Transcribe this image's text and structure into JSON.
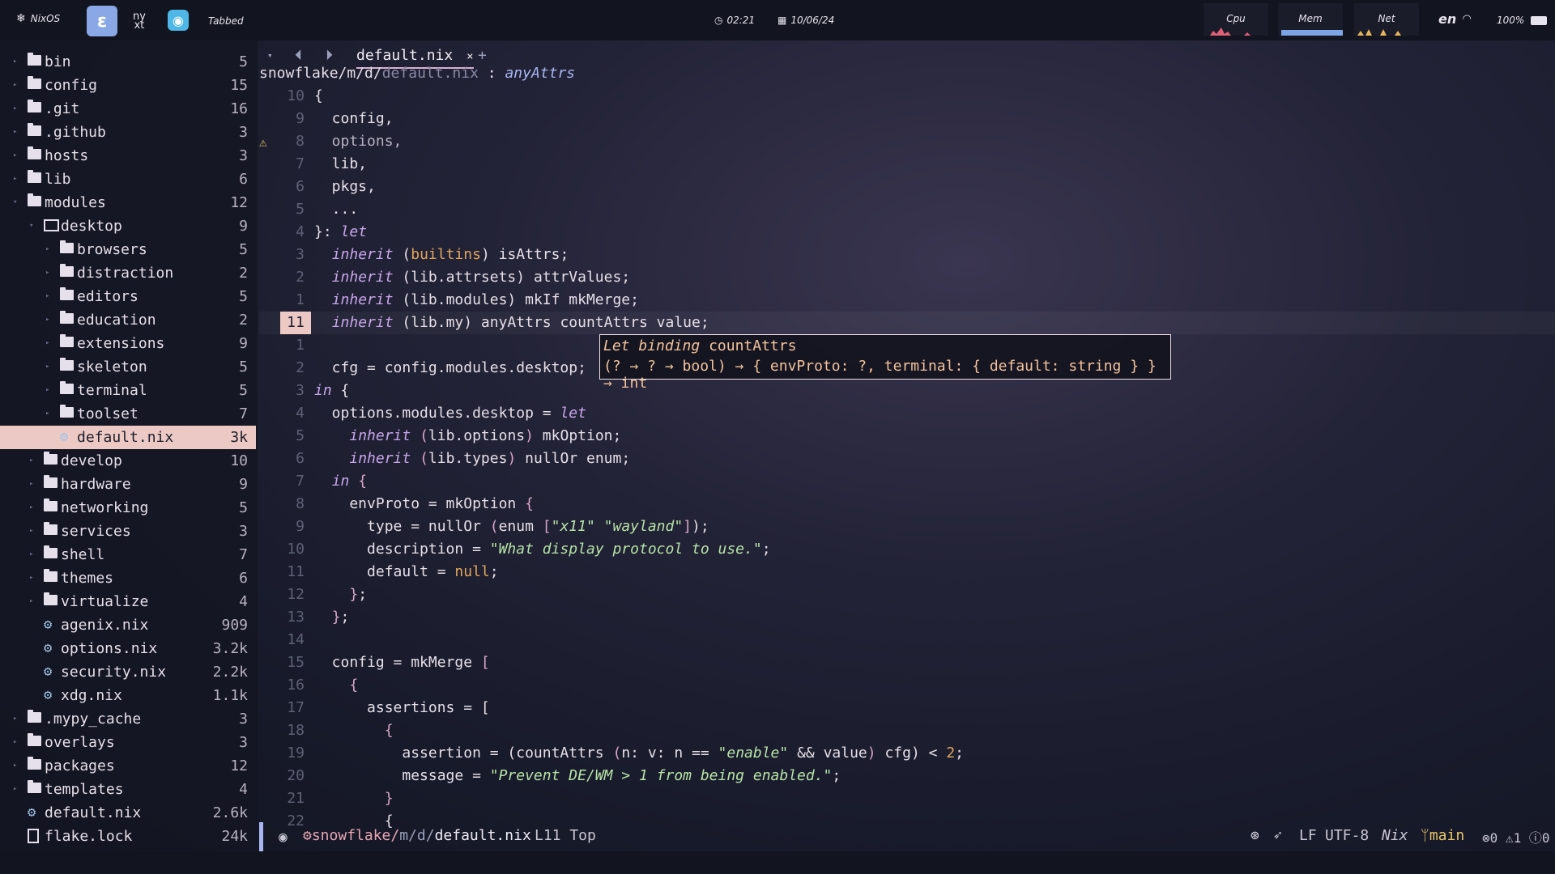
{
  "topbar": {
    "os_label": "NixOS",
    "ws2_text": "ny\nxt",
    "layout": "Tabbed",
    "clock": "02:21",
    "date": "10/06/24",
    "cpu_label": "Cpu",
    "mem_label": "Mem",
    "net_label": "Net",
    "lang": "en",
    "battery": "100%"
  },
  "sidebar": {
    "items": [
      {
        "label": "bin",
        "count": "5",
        "type": "folder",
        "depth": 0
      },
      {
        "label": "config",
        "count": "15",
        "type": "folder",
        "depth": 0
      },
      {
        "label": ".git",
        "count": "16",
        "type": "folder-git",
        "depth": 0
      },
      {
        "label": ".github",
        "count": "3",
        "type": "folder-git",
        "depth": 0
      },
      {
        "label": "hosts",
        "count": "3",
        "type": "folder",
        "depth": 0
      },
      {
        "label": "lib",
        "count": "6",
        "type": "folder",
        "depth": 0
      },
      {
        "label": "modules",
        "count": "12",
        "type": "folder",
        "depth": 0,
        "open": true
      },
      {
        "label": "desktop",
        "count": "9",
        "type": "monitor",
        "depth": 1,
        "open": true
      },
      {
        "label": "browsers",
        "count": "5",
        "type": "folder",
        "depth": 2
      },
      {
        "label": "distraction",
        "count": "2",
        "type": "folder",
        "depth": 2
      },
      {
        "label": "editors",
        "count": "5",
        "type": "folder",
        "depth": 2
      },
      {
        "label": "education",
        "count": "2",
        "type": "folder",
        "depth": 2
      },
      {
        "label": "extensions",
        "count": "9",
        "type": "folder",
        "depth": 2
      },
      {
        "label": "skeleton",
        "count": "5",
        "type": "folder",
        "depth": 2
      },
      {
        "label": "terminal",
        "count": "5",
        "type": "folder",
        "depth": 2
      },
      {
        "label": "toolset",
        "count": "7",
        "type": "folder",
        "depth": 2
      },
      {
        "label": "default.nix",
        "count": "3k",
        "type": "nix",
        "depth": 2,
        "selected": true
      },
      {
        "label": "develop",
        "count": "10",
        "type": "folder",
        "depth": 1
      },
      {
        "label": "hardware",
        "count": "9",
        "type": "folder",
        "depth": 1
      },
      {
        "label": "networking",
        "count": "5",
        "type": "folder",
        "depth": 1
      },
      {
        "label": "services",
        "count": "3",
        "type": "folder",
        "depth": 1
      },
      {
        "label": "shell",
        "count": "7",
        "type": "folder",
        "depth": 1
      },
      {
        "label": "themes",
        "count": "6",
        "type": "folder",
        "depth": 1
      },
      {
        "label": "virtualize",
        "count": "4",
        "type": "folder",
        "depth": 1
      },
      {
        "label": "agenix.nix",
        "count": "909",
        "type": "nix",
        "depth": 1
      },
      {
        "label": "options.nix",
        "count": "3.2k",
        "type": "nix",
        "depth": 1
      },
      {
        "label": "security.nix",
        "count": "2.2k",
        "type": "nix",
        "depth": 1
      },
      {
        "label": "xdg.nix",
        "count": "1.1k",
        "type": "nix",
        "depth": 1
      },
      {
        "label": ".mypy_cache",
        "count": "3",
        "type": "folder",
        "depth": 0
      },
      {
        "label": "overlays",
        "count": "3",
        "type": "folder",
        "depth": 0
      },
      {
        "label": "packages",
        "count": "12",
        "type": "folder",
        "depth": 0
      },
      {
        "label": "templates",
        "count": "4",
        "type": "folder",
        "depth": 0
      },
      {
        "label": "default.nix",
        "count": "2.6k",
        "type": "nix",
        "depth": 0
      },
      {
        "label": "flake.lock",
        "count": "24k",
        "type": "file",
        "depth": 0
      }
    ]
  },
  "tabline": {
    "tab": "default.nix",
    "close": "×",
    "new": "+"
  },
  "breadcrumb": {
    "path_a": "snowflake/m/d/",
    "path_b": "default.nix",
    "sep": " : ",
    "symbol": "anyAttrs"
  },
  "editor": {
    "lines": [
      {
        "ln": "10",
        "html": "{"
      },
      {
        "ln": "9",
        "html": "  config,"
      },
      {
        "ln": "8",
        "html": "  options,",
        "dim": true
      },
      {
        "ln": "7",
        "html": "  lib,"
      },
      {
        "ln": "6",
        "html": "  pkgs,"
      },
      {
        "ln": "5",
        "html": "  ..."
      },
      {
        "ln": "4",
        "html": "}: <span class=kw>let</span>"
      },
      {
        "ln": "3",
        "html": "  <span class=kw>inherit</span> (<span class=lit>builtins</span>) isAttrs;"
      },
      {
        "ln": "2",
        "html": "  <span class=kw>inherit</span> (lib.attrsets) attrValues;"
      },
      {
        "ln": "1",
        "html": "  <span class=kw>inherit</span> (lib.modules) mkIf mkMerge;"
      },
      {
        "ln": "11",
        "html": "  <span class=kw>inherit</span> (lib.my) anyAttrs countAttrs value;",
        "current": true
      },
      {
        "ln": "1",
        "html": ""
      },
      {
        "ln": "2",
        "html": "  cfg = config.modules.desktop;"
      },
      {
        "ln": "3",
        "html": "<span class=kw>in</span> {"
      },
      {
        "ln": "4",
        "html": "  options.modules.desktop = <span class=kw>let</span>"
      },
      {
        "ln": "5",
        "html": "    <span class=kw>inherit</span> <span class=pun>(</span>lib.options<span class=pun>)</span> mkOption;"
      },
      {
        "ln": "6",
        "html": "    <span class=kw>inherit</span> <span class=pun>(</span>lib.types<span class=pun>)</span> nullOr enum;"
      },
      {
        "ln": "7",
        "html": "  <span class=kw>in</span> <span class=pun>{</span>"
      },
      {
        "ln": "8",
        "html": "    envProto = mkOption <span class=pun>{</span>"
      },
      {
        "ln": "9",
        "html": "      type = nullOr <span class=pun>(</span>enum <span class=pun>[</span><span class=str>\"x11\"</span> <span class=str>\"wayland\"</span><span class=pun>]</span>);"
      },
      {
        "ln": "10",
        "html": "      description = <span class=str>\"What display protocol to use.\"</span>;"
      },
      {
        "ln": "11",
        "html": "      default = <span class=lit>null</span>;"
      },
      {
        "ln": "12",
        "html": "    <span class=pun>}</span>;"
      },
      {
        "ln": "13",
        "html": "  <span class=pun>}</span>;"
      },
      {
        "ln": "14",
        "html": ""
      },
      {
        "ln": "15",
        "html": "  config = mkMerge <span class=pun>[</span>"
      },
      {
        "ln": "16",
        "html": "    <span class=pun>{</span>"
      },
      {
        "ln": "17",
        "html": "      assertions = ["
      },
      {
        "ln": "18",
        "html": "        <span class=pun>{</span>"
      },
      {
        "ln": "19",
        "html": "          assertion = (countAttrs <span class=pun>(</span>n: v: n == <span class=str>\"enable\"</span> &amp;&amp; value<span class=pun>)</span> cfg) &lt; <span class=lit>2</span>;"
      },
      {
        "ln": "20",
        "html": "          message = <span class=str>\"Prevent DE/WM &gt; 1 from being enabled.\"</span>;"
      },
      {
        "ln": "21",
        "html": "        <span class=pun>}</span>"
      },
      {
        "ln": "22",
        "html": "        {"
      }
    ]
  },
  "hover": {
    "line1_kind": "Let binding",
    "line1_name": "countAttrs",
    "line2": "(? → ? → bool) → { envProto: ?, terminal: { default: string } } → int"
  },
  "status": {
    "file_a": "snowflake/",
    "file_b": "m/d/",
    "file_c": "default.nix",
    "position": "L11 Top",
    "eol": "LF",
    "encoding": "UTF-8",
    "filetype": "Nix",
    "branch": "main",
    "errors": "0",
    "warnings": "1",
    "hints": "0"
  },
  "colors": {
    "accent_pink": "#ecc9c4",
    "keyword": "#c8a6ea",
    "string": "#b6e3a6",
    "literal": "#e0a65c"
  }
}
